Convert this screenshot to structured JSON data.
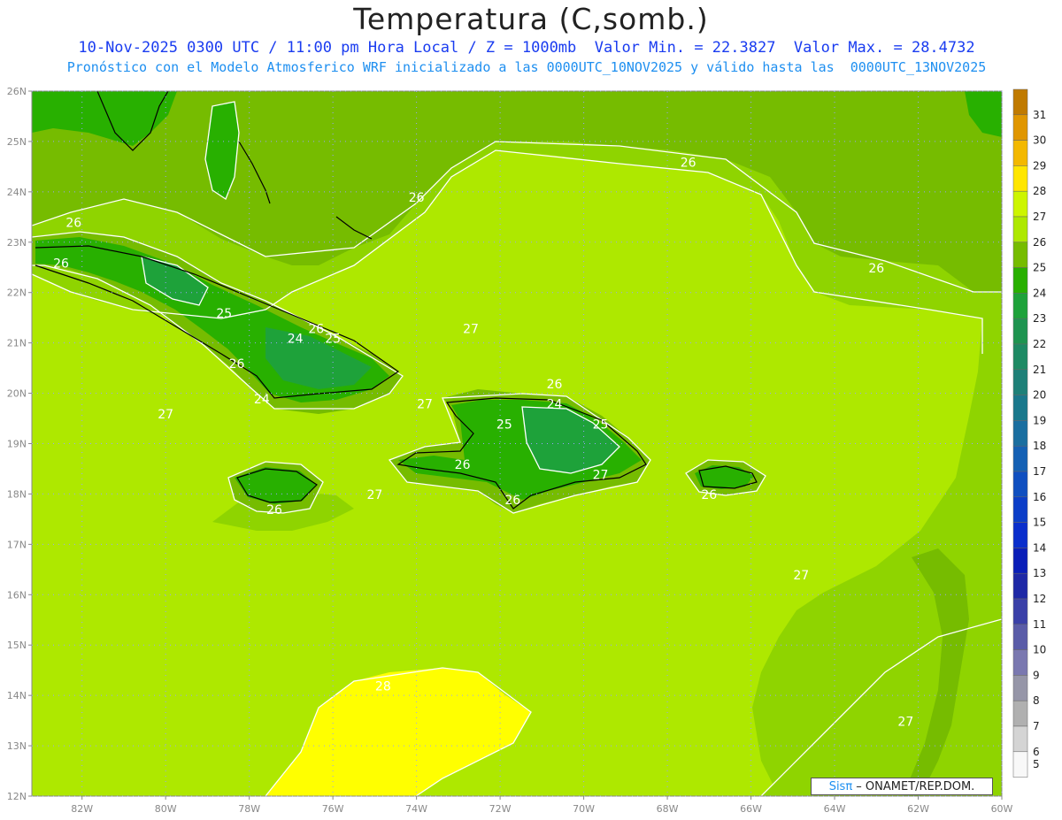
{
  "title": "Temperatura (C,somb.)",
  "subtitle": "10-Nov-2025 0300 UTC / 11:00 pm Hora Local / Z = 1000mb  Valor Min. = 22.3827  Valor Max. = 28.4732",
  "subtitle2": "Pronóstico con el Modelo Atmosferico WRF inicializado a las 0000UTC_10NOV2025 y válido hasta las  0000UTC_13NOV2025",
  "credit_brand": "Sisπ",
  "credit_text": " – ONAMET/REP.DOM.",
  "map": {
    "lat_labels": [
      "26N",
      "25N",
      "24N",
      "23N",
      "22N",
      "21N",
      "20N",
      "19N",
      "18N",
      "17N",
      "16N",
      "15N",
      "14N",
      "13N",
      "12N"
    ],
    "lon_labels": [
      "82W",
      "80W",
      "78W",
      "76W",
      "74W",
      "72W",
      "70W",
      "68W",
      "66W",
      "64W",
      "62W",
      "60W"
    ],
    "lat_range": [
      12,
      26
    ],
    "lon_range": [
      -83.2,
      -60
    ],
    "contour_labels": [
      {
        "text": "26",
        "lon": -82.2,
        "lat": 23.3
      },
      {
        "text": "26",
        "lon": -82.5,
        "lat": 22.5
      },
      {
        "text": "26",
        "lon": -74,
        "lat": 23.8
      },
      {
        "text": "26",
        "lon": -67.5,
        "lat": 24.5
      },
      {
        "text": "26",
        "lon": -63,
        "lat": 22.4
      },
      {
        "text": "25",
        "lon": -78.6,
        "lat": 21.5
      },
      {
        "text": "24",
        "lon": -76.9,
        "lat": 21
      },
      {
        "text": "26",
        "lon": -76.4,
        "lat": 21.2
      },
      {
        "text": "25",
        "lon": -76,
        "lat": 21
      },
      {
        "text": "26",
        "lon": -78.3,
        "lat": 20.5
      },
      {
        "text": "24",
        "lon": -77.7,
        "lat": 19.8
      },
      {
        "text": "27",
        "lon": -72.7,
        "lat": 21.2
      },
      {
        "text": "27",
        "lon": -80,
        "lat": 19.5
      },
      {
        "text": "27",
        "lon": -73.8,
        "lat": 19.7
      },
      {
        "text": "26",
        "lon": -70.7,
        "lat": 20.1
      },
      {
        "text": "24",
        "lon": -70.7,
        "lat": 19.7
      },
      {
        "text": "25",
        "lon": -71.9,
        "lat": 19.3
      },
      {
        "text": "25",
        "lon": -69.6,
        "lat": 19.3
      },
      {
        "text": "26",
        "lon": -72.9,
        "lat": 18.5
      },
      {
        "text": "27",
        "lon": -69.6,
        "lat": 18.3
      },
      {
        "text": "26",
        "lon": -71.7,
        "lat": 17.8
      },
      {
        "text": "27",
        "lon": -75,
        "lat": 17.9
      },
      {
        "text": "26",
        "lon": -77.4,
        "lat": 17.6
      },
      {
        "text": "26",
        "lon": -67,
        "lat": 17.9
      },
      {
        "text": "27",
        "lon": -64.8,
        "lat": 16.3
      },
      {
        "text": "28",
        "lon": -74.8,
        "lat": 14.1
      },
      {
        "text": "27",
        "lon": -62.3,
        "lat": 13.4
      }
    ]
  },
  "colorbar": {
    "labels": [
      "31",
      "30",
      "29",
      "28",
      "27",
      "26",
      "25",
      "24",
      "23",
      "22",
      "21",
      "20",
      "19",
      "18",
      "17",
      "16",
      "15",
      "14",
      "13",
      "12",
      "11",
      "10",
      "9",
      "8",
      "7",
      "6",
      "5"
    ],
    "colors": [
      "#c07a00",
      "#e09600",
      "#f3b800",
      "#ffe600",
      "#cdf500",
      "#aee800",
      "#76bc00",
      "#28b000",
      "#1ea23a",
      "#1e9450",
      "#1e8a64",
      "#1e8078",
      "#1a788c",
      "#1a6ea0",
      "#1460b4",
      "#104fc0",
      "#0c3ec8",
      "#0a2ecc",
      "#0a1eb8",
      "#1e28a6",
      "#3a40a8",
      "#5a5ca8",
      "#7a78b0",
      "#9696a8",
      "#b0b0b0",
      "#d4d4d4",
      "#f8f8f8"
    ]
  }
}
